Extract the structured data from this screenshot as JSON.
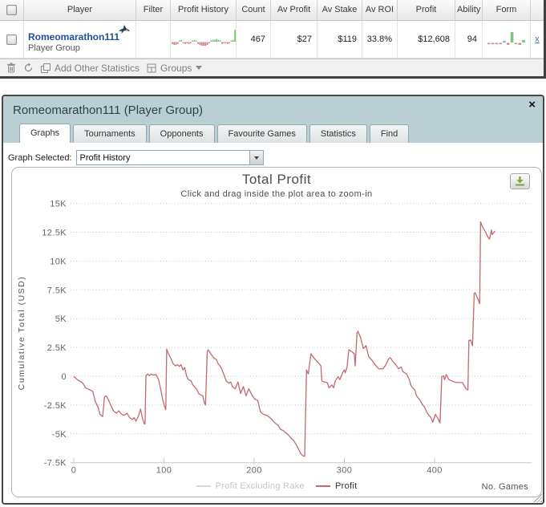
{
  "table": {
    "columns": [
      "Player",
      "Filter",
      "Profit History",
      "Count",
      "Av Profit",
      "Av Stake",
      "Av ROI",
      "Profit",
      "Ability",
      "Form"
    ],
    "row": {
      "player_name": "Romeomarathon111",
      "player_type": "Player Group",
      "count": "467",
      "av_profit": "$27",
      "av_stake": "$119",
      "av_roi": "33.8%",
      "profit": "$12,608",
      "ability": "94",
      "remove_label": "x"
    },
    "profit_history_spark": [
      -2,
      -3,
      -3,
      -2,
      1,
      2,
      -1,
      -2,
      -1,
      -2,
      -1,
      1,
      2,
      1,
      -2,
      -3,
      -4,
      -4,
      -4,
      -3,
      -1,
      1,
      2,
      2,
      3,
      2,
      1,
      -2,
      -1,
      -1,
      -2,
      -1,
      1,
      2,
      13
    ],
    "form_spark": [
      -1,
      -1,
      -1,
      -1,
      2,
      -2,
      12,
      -1,
      -2,
      3
    ]
  },
  "toolbar": {
    "add_other_statistics_label": "Add Other Statistics",
    "groups_label": "Groups"
  },
  "dialog": {
    "title": "Romeomarathon111 (Player Group)",
    "close_label": "×",
    "tabs": [
      {
        "label": "Graphs",
        "active": true
      },
      {
        "label": "Tournaments",
        "active": false
      },
      {
        "label": "Opponents",
        "active": false
      },
      {
        "label": "Favourite Games",
        "active": false
      },
      {
        "label": "Statistics",
        "active": false
      },
      {
        "label": "Find",
        "active": false
      }
    ],
    "graph_selected_label": "Graph Selected:",
    "graph_selected_value": "Profit History"
  },
  "chart_data": {
    "type": "line",
    "title": "Total Profit",
    "subtitle": "Click and drag inside the plot area to zoom-in",
    "ylabel": "Cumulative Total (USD)",
    "xlabel": "No. Games",
    "ylim": [
      -7500,
      15000
    ],
    "xlim": [
      0,
      485
    ],
    "grid": true,
    "legend_position": "bottom-center",
    "ytick_values": [
      15000,
      12500,
      10000,
      7500,
      5000,
      2500,
      0,
      -2500,
      -5000,
      -7500
    ],
    "ytick_labels": [
      "15K",
      "12.5K",
      "10K",
      "7.5K",
      "5K",
      "2.5K",
      "0",
      "-2.5K",
      "-5K",
      "-7.5K"
    ],
    "xticks": [
      0,
      100,
      200,
      300,
      400
    ],
    "legend": [
      {
        "label": "Profit Excluding Rake",
        "color": "#d6d6d6",
        "text_color": "#c5c5c5",
        "disabled": true
      },
      {
        "label": "Profit",
        "color": "#c4696f",
        "text_color": "#333333",
        "disabled": false
      }
    ],
    "series": [
      {
        "name": "Profit",
        "color": "#c4696f",
        "points": [
          [
            0,
            0
          ],
          [
            4,
            -300
          ],
          [
            10,
            -600
          ],
          [
            13,
            -1000
          ],
          [
            18,
            -1200
          ],
          [
            21,
            -1300
          ],
          [
            24,
            -2200
          ],
          [
            27,
            -2700
          ],
          [
            29,
            -3300
          ],
          [
            32,
            -3500
          ],
          [
            34,
            -1800
          ],
          [
            36,
            -1700
          ],
          [
            38,
            -2000
          ],
          [
            41,
            -2500
          ],
          [
            44,
            -3000
          ],
          [
            47,
            -3200
          ],
          [
            50,
            -3000
          ],
          [
            53,
            -3300
          ],
          [
            56,
            -3400
          ],
          [
            59,
            -3200
          ],
          [
            62,
            -3600
          ],
          [
            65,
            -3750
          ],
          [
            67,
            -3600
          ],
          [
            69,
            -3900
          ],
          [
            72,
            -3400
          ],
          [
            74,
            -2850
          ],
          [
            76,
            -3600
          ],
          [
            78,
            -4100
          ],
          [
            79,
            -4150
          ],
          [
            80,
            50
          ],
          [
            82,
            200
          ],
          [
            84,
            50
          ],
          [
            86,
            200
          ],
          [
            88,
            100
          ],
          [
            91,
            150
          ],
          [
            94,
            -300
          ],
          [
            96,
            -1000
          ],
          [
            99,
            -2150
          ],
          [
            101,
            -2700
          ],
          [
            102,
            -2900
          ],
          [
            103,
            2350
          ],
          [
            105,
            1950
          ],
          [
            108,
            1500
          ],
          [
            110,
            1100
          ],
          [
            113,
            900
          ],
          [
            115,
            1000
          ],
          [
            117,
            850
          ],
          [
            119,
            1000
          ],
          [
            121,
            550
          ],
          [
            123,
            750
          ],
          [
            125,
            50
          ],
          [
            127,
            -300
          ],
          [
            130,
            -400
          ],
          [
            132,
            -750
          ],
          [
            136,
            -1100
          ],
          [
            139,
            -1550
          ],
          [
            143,
            -1700
          ],
          [
            145,
            -2350
          ],
          [
            146,
            -2500
          ],
          [
            148,
            2150
          ],
          [
            149,
            2300
          ],
          [
            152,
            1950
          ],
          [
            155,
            1600
          ],
          [
            158,
            1450
          ],
          [
            160,
            1100
          ],
          [
            162,
            900
          ],
          [
            164,
            650
          ],
          [
            166,
            200
          ],
          [
            169,
            -400
          ],
          [
            172,
            -600
          ],
          [
            174,
            -500
          ],
          [
            176,
            -900
          ],
          [
            179,
            -1100
          ],
          [
            182,
            -500
          ],
          [
            185,
            -1500
          ],
          [
            188,
            -900
          ],
          [
            191,
            -1700
          ],
          [
            194,
            -1100
          ],
          [
            198,
            -1700
          ],
          [
            201,
            -2000
          ],
          [
            204,
            -2100
          ],
          [
            207,
            -3100
          ],
          [
            210,
            -3300
          ],
          [
            214,
            -3400
          ],
          [
            216,
            -3500
          ],
          [
            219,
            -3700
          ],
          [
            222,
            -4000
          ],
          [
            227,
            -4300
          ],
          [
            229,
            -4600
          ],
          [
            232,
            -4700
          ],
          [
            235,
            -4900
          ],
          [
            238,
            -5100
          ],
          [
            240,
            -5300
          ],
          [
            244,
            -5600
          ],
          [
            247,
            -6000
          ],
          [
            249,
            -6300
          ],
          [
            252,
            -6750
          ],
          [
            254,
            -6900
          ],
          [
            256,
            -6950
          ],
          [
            258,
            550
          ],
          [
            260,
            200
          ],
          [
            263,
            1950
          ],
          [
            266,
            1600
          ],
          [
            269,
            1350
          ],
          [
            272,
            1100
          ],
          [
            274,
            900
          ],
          [
            275,
            -400
          ],
          [
            278,
            -500
          ],
          [
            281,
            -550
          ],
          [
            283,
            -1000
          ],
          [
            286,
            -750
          ],
          [
            288,
            -1000
          ],
          [
            290,
            -400
          ],
          [
            293,
            -50
          ],
          [
            295,
            -300
          ],
          [
            298,
            300
          ],
          [
            300,
            550
          ],
          [
            301,
            300
          ],
          [
            303,
            800
          ],
          [
            305,
            2300
          ],
          [
            308,
            2150
          ],
          [
            311,
            1950
          ],
          [
            312,
            900
          ],
          [
            314,
            3750
          ],
          [
            315,
            3900
          ],
          [
            318,
            3350
          ],
          [
            321,
            2400
          ],
          [
            324,
            2650
          ],
          [
            327,
            1700
          ],
          [
            331,
            1350
          ],
          [
            334,
            1000
          ],
          [
            338,
            650
          ],
          [
            343,
            650
          ],
          [
            346,
            1000
          ],
          [
            349,
            1500
          ],
          [
            351,
            1600
          ],
          [
            354,
            1250
          ],
          [
            357,
            1000
          ],
          [
            360,
            650
          ],
          [
            363,
            800
          ],
          [
            365,
            400
          ],
          [
            369,
            200
          ],
          [
            372,
            -300
          ],
          [
            374,
            -850
          ],
          [
            378,
            -1200
          ],
          [
            380,
            -1700
          ],
          [
            383,
            -2000
          ],
          [
            387,
            -2500
          ],
          [
            389,
            -2700
          ],
          [
            392,
            -3200
          ],
          [
            396,
            -3600
          ],
          [
            398,
            -4000
          ],
          [
            401,
            -3300
          ],
          [
            404,
            -3700
          ],
          [
            406,
            -4050
          ],
          [
            408,
            -50
          ],
          [
            410,
            50
          ],
          [
            411,
            -300
          ],
          [
            413,
            150
          ],
          [
            416,
            -300
          ],
          [
            419,
            -400
          ],
          [
            422,
            -500
          ],
          [
            425,
            -550
          ],
          [
            431,
            -550
          ],
          [
            435,
            -1100
          ],
          [
            437,
            -1200
          ],
          [
            438,
            3100
          ],
          [
            440,
            3150
          ],
          [
            442,
            2650
          ],
          [
            444,
            7200
          ],
          [
            445,
            7250
          ],
          [
            448,
            6700
          ],
          [
            450,
            6300
          ],
          [
            451,
            13400
          ],
          [
            453,
            13000
          ],
          [
            456,
            12600
          ],
          [
            459,
            12100
          ],
          [
            461,
            11900
          ],
          [
            463,
            12700
          ],
          [
            464,
            12300
          ],
          [
            467,
            12608
          ]
        ]
      }
    ]
  }
}
